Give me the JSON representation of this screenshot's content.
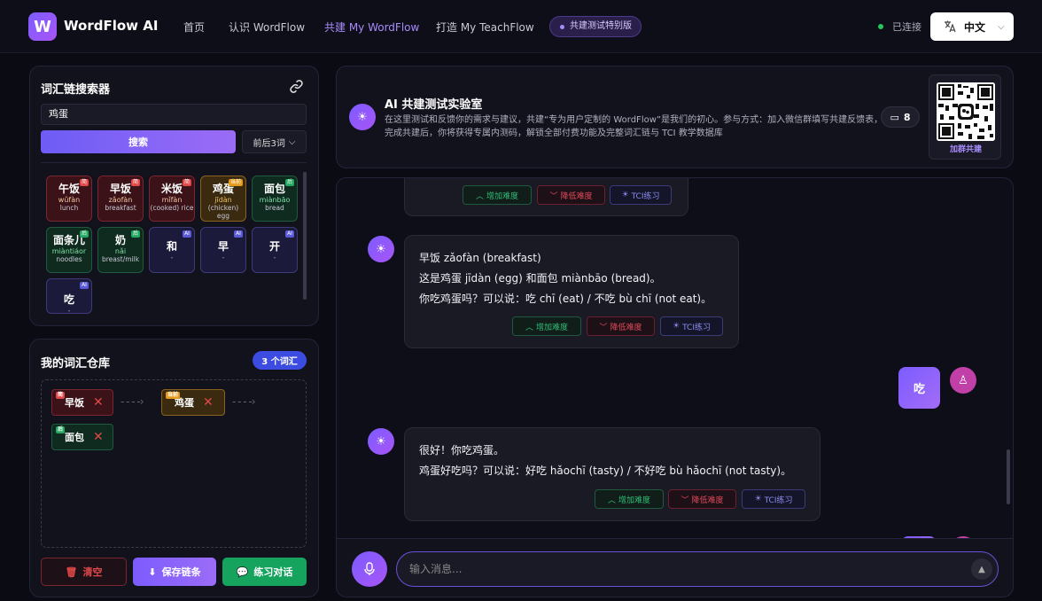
{
  "header": {
    "logo_letter": "W",
    "brand": "WordFlow AI",
    "nav": [
      "首页",
      "认识 WordFlow",
      "共建 My WordFlow",
      "打造 My TeachFlow"
    ],
    "beta_badge": "共建测试特别版",
    "status": "已连接",
    "language": "中文"
  },
  "search_panel": {
    "title": "词汇链搜索器",
    "query": "鸡蛋",
    "search_button": "搜索",
    "range_select": "前后3词",
    "cards": [
      {
        "hanzi": "午饭",
        "pinyin": "wǔfàn",
        "english": "lunch",
        "tag": "简"
      },
      {
        "hanzi": "早饭",
        "pinyin": "zǎofàn",
        "english": "breakfast",
        "tag": "简"
      },
      {
        "hanzi": "米饭",
        "pinyin": "mǐfàn",
        "english": "(cooked) rice",
        "tag": "简"
      },
      {
        "hanzi": "鸡蛋",
        "pinyin": "jīdàn",
        "english": "(chicken) egg",
        "tag": "当前"
      },
      {
        "hanzi": "面包",
        "pinyin": "miànbāo",
        "english": "bread",
        "tag": "后"
      },
      {
        "hanzi": "面条儿",
        "pinyin": "miàntiáor",
        "english": "noodles",
        "tag": "后"
      },
      {
        "hanzi": "奶",
        "pinyin": "nǎi",
        "english": "breast/milk",
        "tag": "后"
      },
      {
        "hanzi": "和",
        "pinyin": "-",
        "english": "",
        "tag": "AI"
      },
      {
        "hanzi": "早",
        "pinyin": "-",
        "english": "",
        "tag": "AI"
      },
      {
        "hanzi": "开",
        "pinyin": "-",
        "english": "",
        "tag": "AI"
      },
      {
        "hanzi": "吃",
        "pinyin": "-",
        "english": "",
        "tag": "AI"
      }
    ]
  },
  "repo_panel": {
    "title": "我的词汇仓库",
    "count_badge": "3 个词汇",
    "chips": [
      {
        "word": "早饭",
        "tag": "简"
      },
      {
        "word": "鸡蛋",
        "tag": "当前"
      },
      {
        "word": "面包",
        "tag": "后"
      }
    ],
    "buttons": {
      "clear": "清空",
      "save": "保存链条",
      "practice": "练习对话"
    }
  },
  "lab": {
    "title": "AI 共建测试实验室",
    "description": "在这里测试和反馈你的需求与建议，共建“专为用户定制的 WordFlow”是我们的初心。参与方式：加入微信群填写共建反馈表，完成共建后，你将获得专属内测码，解锁全部付费功能及完整词汇链与 TCI 教学数据库",
    "comment_count": "8",
    "qr_label": "加群共建"
  },
  "chat": {
    "action_labels": {
      "up": "增加难度",
      "down": "降低难度",
      "tci": "TCI练习"
    },
    "msg1": {
      "lines": [
        "早饭 zǎofàn (breakfast)",
        "这是鸡蛋 jīdàn (egg) 和面包 miànbāo (bread)。",
        "你吃鸡蛋吗？可以说：吃 chī (eat) / 不吃 bù chī (not eat)。"
      ]
    },
    "user_msg": "吃",
    "msg2": {
      "lines": [
        "很好！你吃鸡蛋。",
        "鸡蛋好吃吗？可以说：好吃 hǎochī (tasty) / 不好吃 bù hǎochī (not tasty)。"
      ]
    },
    "input_placeholder": "输入消息..."
  },
  "colors": {
    "accent": "#7c5cff",
    "connected": "#22c55e",
    "danger": "#e04848",
    "success": "#16a34a"
  }
}
